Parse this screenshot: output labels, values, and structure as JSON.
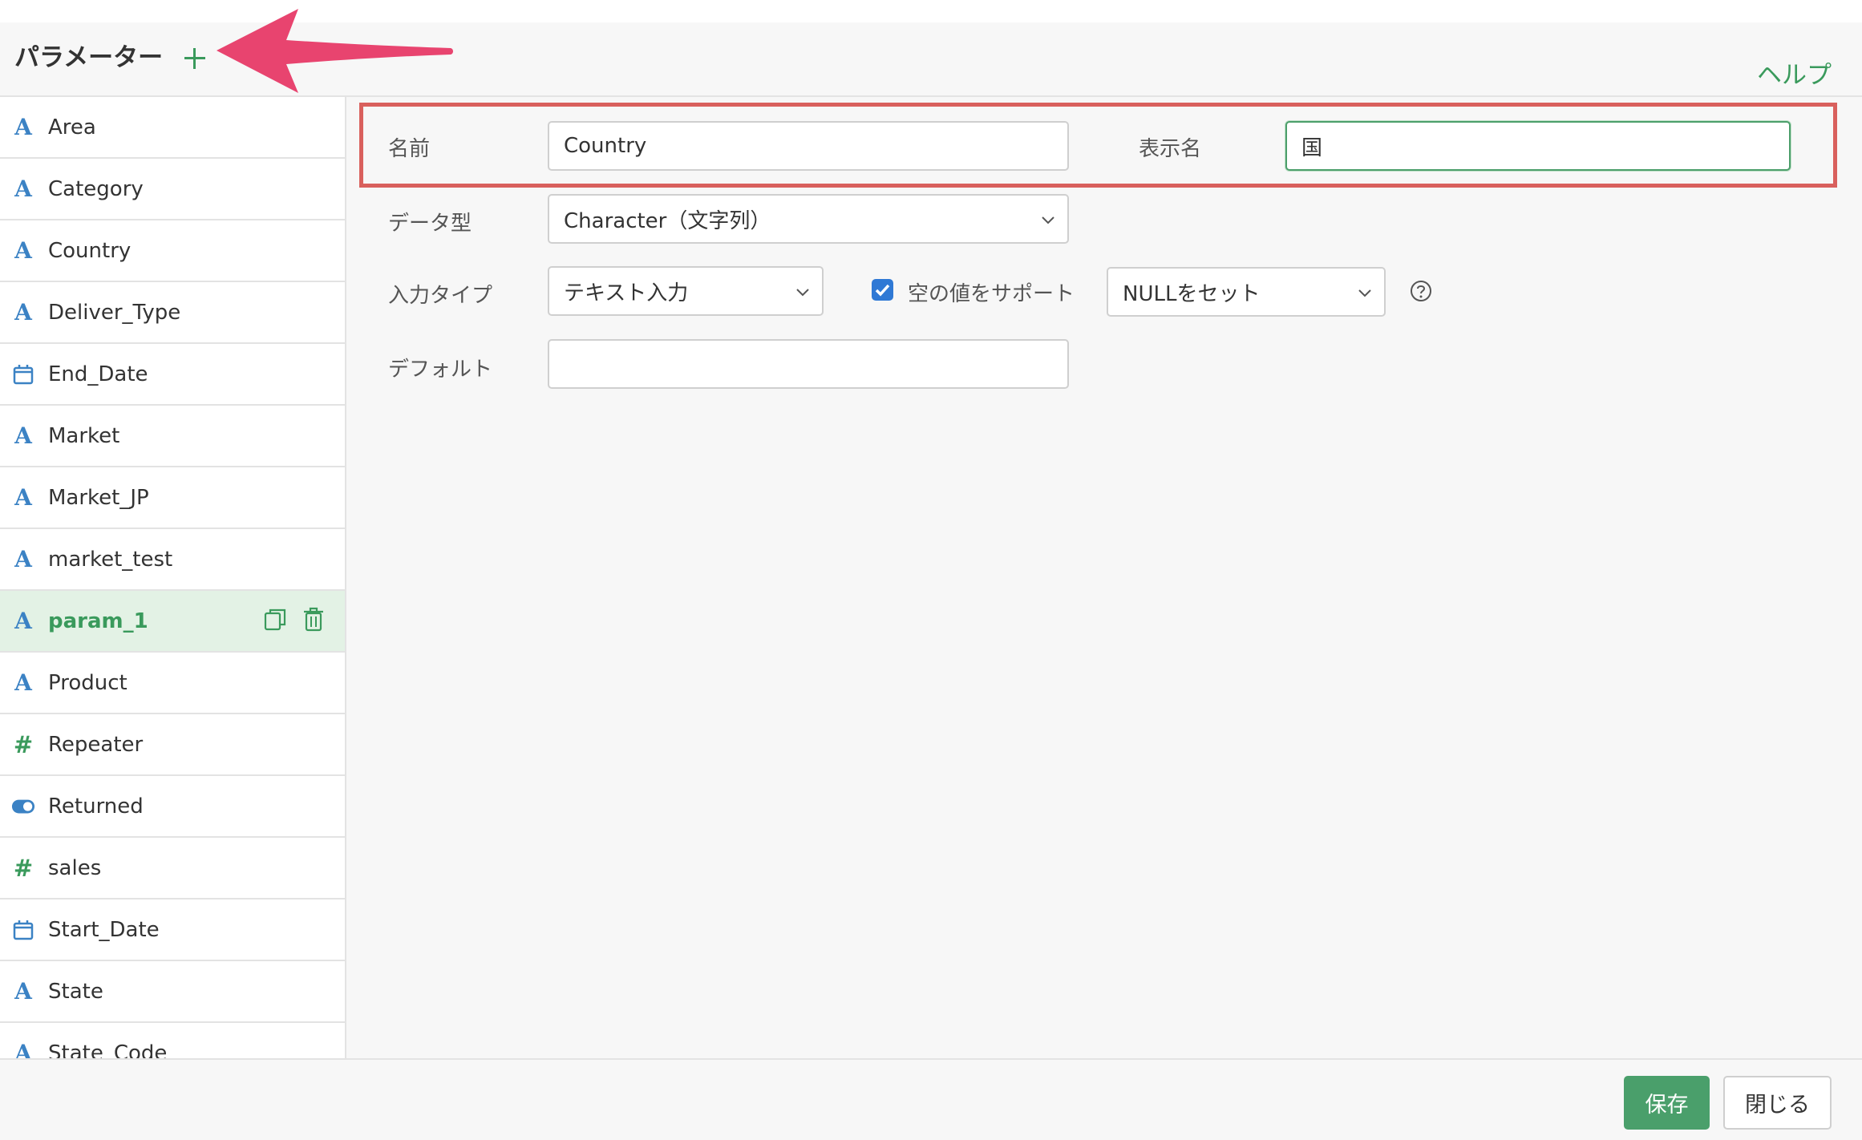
{
  "header": {
    "title": "パラメーター",
    "add_icon": "plus-icon",
    "help_label": "ヘルプ"
  },
  "sidebar": {
    "items": [
      {
        "label": "Area",
        "type": "text"
      },
      {
        "label": "Category",
        "type": "text"
      },
      {
        "label": "Country",
        "type": "text"
      },
      {
        "label": "Deliver_Type",
        "type": "text"
      },
      {
        "label": "End_Date",
        "type": "date"
      },
      {
        "label": "Market",
        "type": "text"
      },
      {
        "label": "Market_JP",
        "type": "text"
      },
      {
        "label": "market_test",
        "type": "text"
      },
      {
        "label": "param_1",
        "type": "text",
        "active": true
      },
      {
        "label": "Product",
        "type": "text"
      },
      {
        "label": "Repeater",
        "type": "number"
      },
      {
        "label": "Returned",
        "type": "toggle"
      },
      {
        "label": "sales",
        "type": "number"
      },
      {
        "label": "Start_Date",
        "type": "date"
      },
      {
        "label": "State",
        "type": "text"
      },
      {
        "label": "State_Code",
        "type": "text"
      }
    ],
    "type_glyphs": {
      "text": "A",
      "number": "#"
    }
  },
  "form": {
    "name_label": "名前",
    "name_value": "Country",
    "display_name_label": "表示名",
    "display_name_value": "国",
    "data_type_label": "データ型",
    "data_type_value": "Character（文字列）",
    "input_type_label": "入力タイプ",
    "input_type_value": "テキスト入力",
    "support_empty_label": "空の値をサポート",
    "support_empty_checked": true,
    "empty_value_option": "NULLをセット",
    "default_label": "デフォルト",
    "default_value": ""
  },
  "footer": {
    "save_label": "保存",
    "close_label": "閉じる"
  },
  "colors": {
    "accent_green": "#3a9a5c",
    "text_type_blue": "#3b82c4",
    "highlight_red": "#d9605d",
    "arrow_pink": "#e8446f",
    "checkbox_blue": "#2f79d5"
  }
}
